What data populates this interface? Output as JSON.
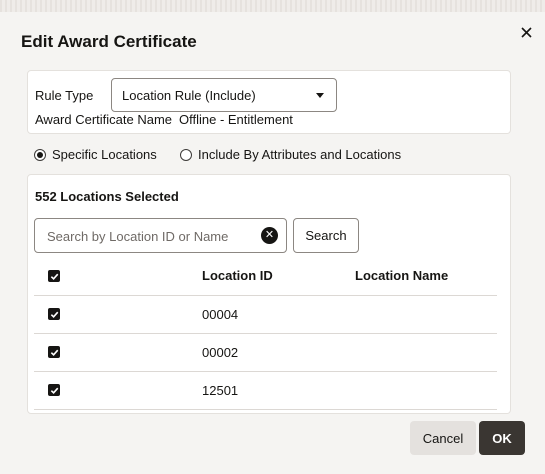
{
  "dialog": {
    "title": "Edit Award Certificate",
    "close_icon": "close-icon"
  },
  "rule": {
    "rule_type_label": "Rule Type",
    "rule_type_value": "Location Rule (Include)",
    "award_certificate_name_label": "Award Certificate Name",
    "award_certificate_name_value": "Offline - Entitlement"
  },
  "location_mode": {
    "options": [
      {
        "label": "Specific Locations",
        "selected": true
      },
      {
        "label": "Include By Attributes and Locations",
        "selected": false
      }
    ]
  },
  "locations": {
    "selected_count_text": "552 Locations Selected",
    "search_placeholder": "Search by Location ID or Name",
    "search_value": "",
    "search_button": "Search",
    "columns": [
      "Location ID",
      "Location Name"
    ],
    "header_checked": true,
    "rows": [
      {
        "checked": true,
        "location_id": "00004",
        "location_name": ""
      },
      {
        "checked": true,
        "location_id": "00002",
        "location_name": ""
      },
      {
        "checked": true,
        "location_id": "12501",
        "location_name": ""
      }
    ]
  },
  "footer": {
    "cancel_label": "Cancel",
    "ok_label": "OK"
  },
  "colors": {
    "primary_button": "#3a3632",
    "secondary_button": "#e4e1de",
    "background": "#f5f4f2"
  }
}
